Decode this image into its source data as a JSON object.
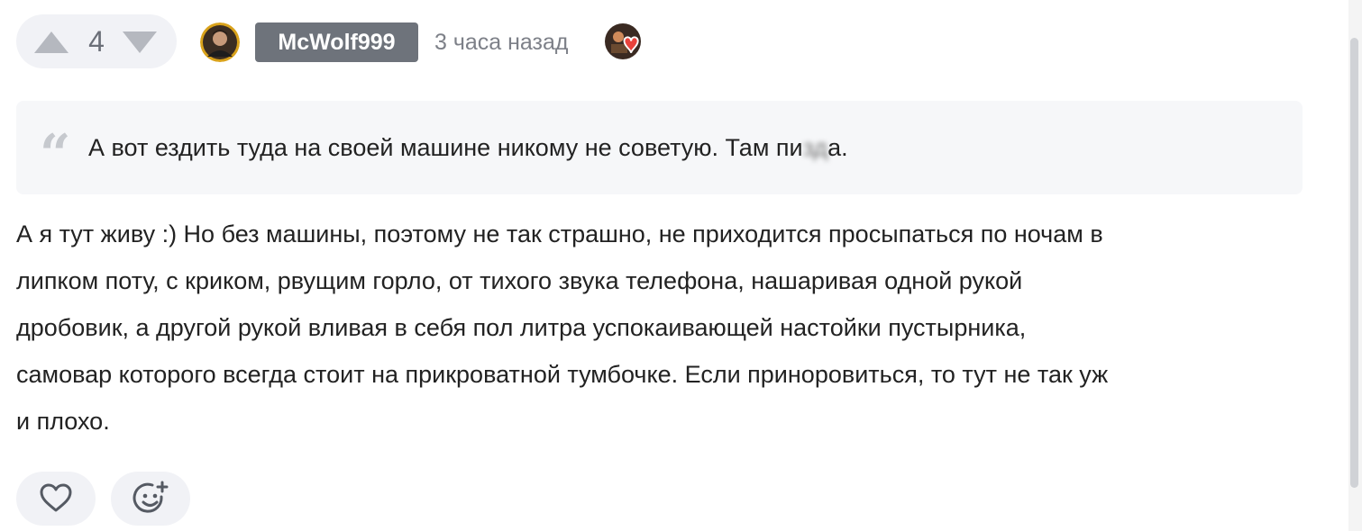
{
  "comment": {
    "votes": {
      "score": "4",
      "upvote_icon": "triangle-up-icon",
      "downvote_icon": "triangle-down-icon"
    },
    "author": {
      "avatar_icon": "user-avatar",
      "username": "McWolf999"
    },
    "timestamp": "3 часа назад",
    "award_icon": "heart-award-icon",
    "quote": {
      "text_before": "А вот ездить туда на своей машине никому не советую. Там пи",
      "text_censored": "зд",
      "text_after": "а."
    },
    "body_lines": [
      "А я тут живу :) Но без машины, поэтому не так страшно, не приходится просыпаться по ночам в",
      "липком поту, с криком, рвущим горло, от тихого звука телефона, нашаривая одной рукой",
      "дробовик, а другой рукой вливая в себя пол литра успокаивающей настойки пустырника,",
      "самовар которого всегда стоит на прикроватной тумбочке. Если приноровиться, то тут не так уж",
      "и плохо."
    ],
    "actions": {
      "like_icon": "heart-icon",
      "reaction_icon": "add-emoji-icon"
    }
  },
  "colors": {
    "pill_bg": "#f1f2f6",
    "arrow": "#b5b8bf",
    "badge_bg": "#6e737b",
    "quote_bg": "#f6f7f9"
  }
}
